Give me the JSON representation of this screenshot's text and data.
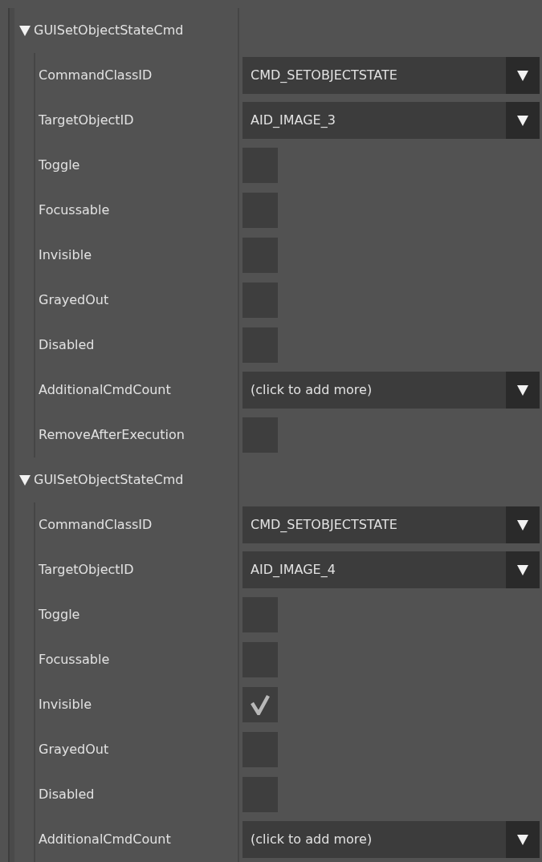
{
  "groups": [
    {
      "title": "GUISetObjectStateCmd",
      "expanded": true,
      "properties": [
        {
          "label": "CommandClassID",
          "kind": "dropdown",
          "value": "CMD_SETOBJECTSTATE"
        },
        {
          "label": "TargetObjectID",
          "kind": "dropdown",
          "value": "AID_IMAGE_3"
        },
        {
          "label": "Toggle",
          "kind": "checkbox",
          "checked": false
        },
        {
          "label": "Focussable",
          "kind": "checkbox",
          "checked": false
        },
        {
          "label": "Invisible",
          "kind": "checkbox",
          "checked": false
        },
        {
          "label": "GrayedOut",
          "kind": "checkbox",
          "checked": false
        },
        {
          "label": "Disabled",
          "kind": "checkbox",
          "checked": false
        },
        {
          "label": "AdditionalCmdCount",
          "kind": "dropdown",
          "value": "(click to add more)"
        },
        {
          "label": "RemoveAfterExecution",
          "kind": "checkbox",
          "checked": false
        }
      ]
    },
    {
      "title": "GUISetObjectStateCmd",
      "expanded": true,
      "properties": [
        {
          "label": "CommandClassID",
          "kind": "dropdown",
          "value": "CMD_SETOBJECTSTATE"
        },
        {
          "label": "TargetObjectID",
          "kind": "dropdown",
          "value": "AID_IMAGE_4"
        },
        {
          "label": "Toggle",
          "kind": "checkbox",
          "checked": false
        },
        {
          "label": "Focussable",
          "kind": "checkbox",
          "checked": false
        },
        {
          "label": "Invisible",
          "kind": "checkbox",
          "checked": true
        },
        {
          "label": "GrayedOut",
          "kind": "checkbox",
          "checked": false
        },
        {
          "label": "Disabled",
          "kind": "checkbox",
          "checked": false
        },
        {
          "label": "AdditionalCmdCount",
          "kind": "dropdown",
          "value": "(click to add more)"
        }
      ]
    }
  ]
}
